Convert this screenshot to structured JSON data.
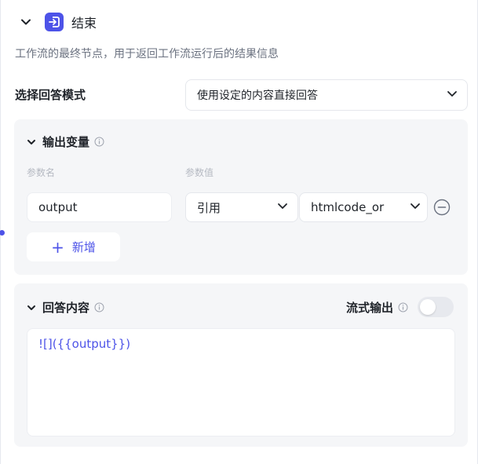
{
  "node": {
    "title": "结束",
    "description": "工作流的最终节点，用于返回工作流运行后的结果信息",
    "icon": "exit-node-icon",
    "accent_color": "#4d53e8"
  },
  "answer_mode": {
    "label": "选择回答模式",
    "selected": "使用设定的内容直接回答"
  },
  "output_vars": {
    "title": "输出变量",
    "col_name": "参数名",
    "col_value": "参数值",
    "rows": [
      {
        "name": "output",
        "ref_type": "引用",
        "value": "htmlcode_or"
      }
    ],
    "add_label": "新增"
  },
  "answer_content": {
    "title": "回答内容",
    "stream_label": "流式输出",
    "stream_enabled": false,
    "content": "![]({{output}})"
  }
}
